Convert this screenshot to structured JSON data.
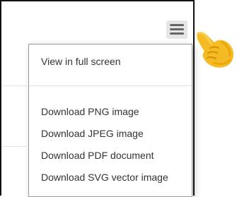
{
  "chart": {
    "context_button": {
      "icon": "hamburger-menu-icon"
    },
    "pointer": {
      "icon": "pointing-hand-emoji-icon",
      "color": "#f5bb24"
    },
    "export_menu": {
      "items": [
        {
          "label": "View in full screen"
        },
        {
          "label": "Download PNG image"
        },
        {
          "label": "Download JPEG image"
        },
        {
          "label": "Download PDF document"
        },
        {
          "label": "Download SVG vector image"
        }
      ]
    }
  }
}
